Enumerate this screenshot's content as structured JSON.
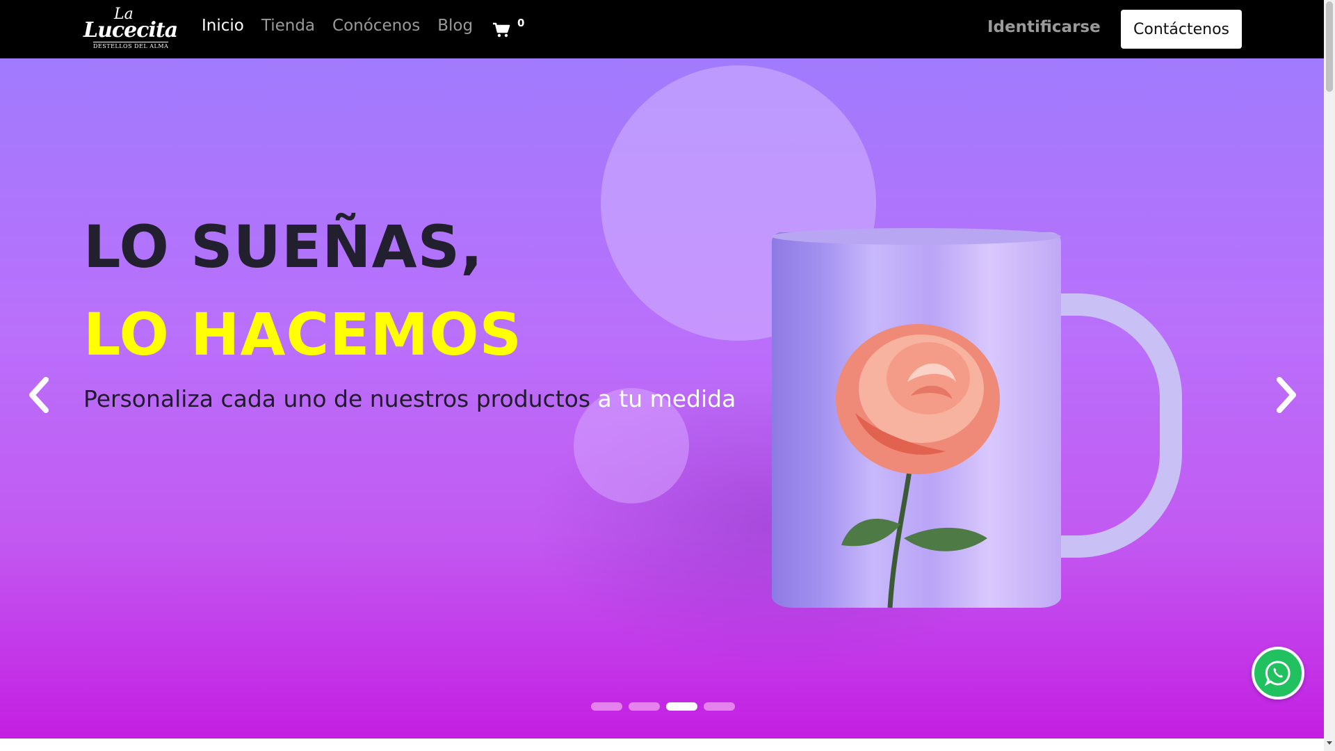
{
  "navbar": {
    "logo": {
      "top": "La",
      "main": "Lucecita",
      "tagline": "DESTELLOS DEL ALMA"
    },
    "links": [
      {
        "label": "Inicio",
        "active": true
      },
      {
        "label": "Tienda",
        "active": false
      },
      {
        "label": "Conócenos",
        "active": false
      },
      {
        "label": "Blog",
        "active": false
      }
    ],
    "cart": {
      "icon": "shopping-cart-icon",
      "count": "0"
    },
    "login_label": "Identificarse",
    "contact_label": "Contáctenos"
  },
  "hero": {
    "headline_1": "LO SUEÑAS,",
    "headline_2": "LO HACEMOS",
    "subtitle_main": "Personaliza cada uno de nuestros productos",
    "subtitle_highlight": "a tu medida",
    "image": "mug-with-rose",
    "slides_total": 4,
    "active_slide": 3,
    "prev_icon": "chevron-left-icon",
    "next_icon": "chevron-right-icon"
  },
  "whatsapp": {
    "icon": "whatsapp-icon"
  },
  "colors": {
    "nav_bg": "#000000",
    "accent_yellow": "#ffff00",
    "hero_top": "#a17bfd",
    "hero_bottom": "#c31fe2",
    "whatsapp_green": "#21c15f"
  }
}
